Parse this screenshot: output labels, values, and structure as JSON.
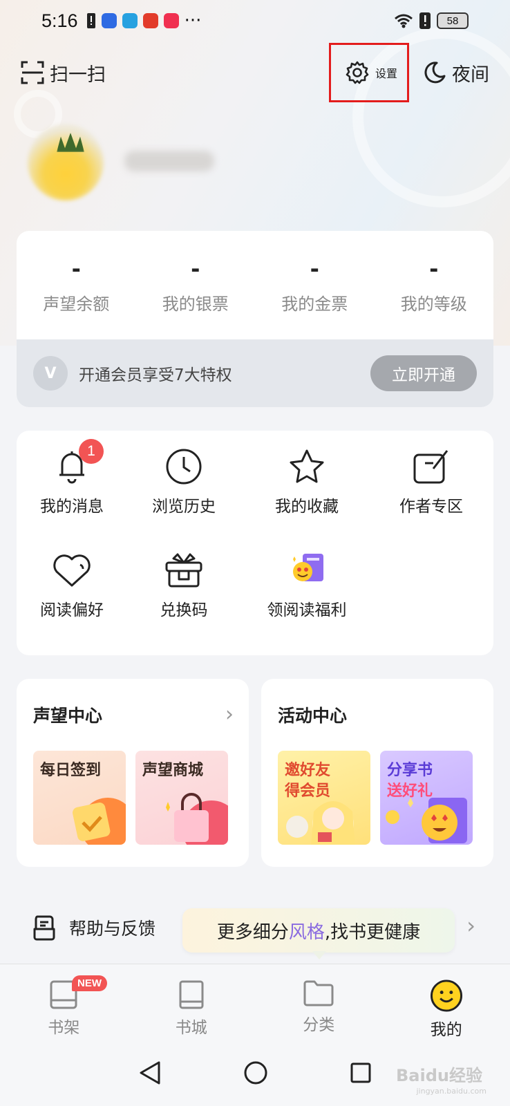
{
  "status_bar": {
    "time": "5:16",
    "more": "···",
    "battery": "58"
  },
  "header": {
    "scan_label": "扫一扫",
    "settings_label": "设置",
    "night_label": "夜间"
  },
  "stats": [
    {
      "value": "-",
      "label": "声望余额"
    },
    {
      "value": "-",
      "label": "我的银票"
    },
    {
      "value": "-",
      "label": "我的金票"
    },
    {
      "value": "-",
      "label": "我的等级"
    }
  ],
  "vip": {
    "icon_letter": "V",
    "text": "开通会员享受7大特权",
    "button": "立即开通"
  },
  "menu": [
    {
      "label": "我的消息",
      "icon": "bell-icon",
      "badge": "1"
    },
    {
      "label": "浏览历史",
      "icon": "clock-icon"
    },
    {
      "label": "我的收藏",
      "icon": "star-icon"
    },
    {
      "label": "作者专区",
      "icon": "edit-icon"
    },
    {
      "label": "阅读偏好",
      "icon": "heart-icon"
    },
    {
      "label": "兑换码",
      "icon": "gift-icon"
    },
    {
      "label": "领阅读福利",
      "icon": "reward-icon"
    }
  ],
  "reputation_center": {
    "title": "声望中心",
    "tiles": [
      "每日签到",
      "声望商城"
    ]
  },
  "activity_center": {
    "title": "活动中心",
    "tiles": [
      {
        "line1": "邀好友",
        "line2": "得会员"
      },
      {
        "line1": "分享书",
        "line2": "送好礼"
      }
    ]
  },
  "help": {
    "label": "帮助与反馈",
    "tip_before": "更多细分",
    "tip_highlight": "风格",
    "tip_after": ",找书更健康"
  },
  "bottom_nav": [
    {
      "label": "书架",
      "badge": "NEW"
    },
    {
      "label": "书城"
    },
    {
      "label": "分类"
    },
    {
      "label": "我的",
      "active": true
    }
  ],
  "watermark": {
    "text": "Baidu经验",
    "sub": "jingyan.baidu.com"
  },
  "colors": {
    "highlight_box": "#e31c1c",
    "badge": "#f25454",
    "accent_purple": "#8a6be0",
    "vip_button": "#a5a8ad",
    "active_tab_icon": "#ffd21f"
  }
}
